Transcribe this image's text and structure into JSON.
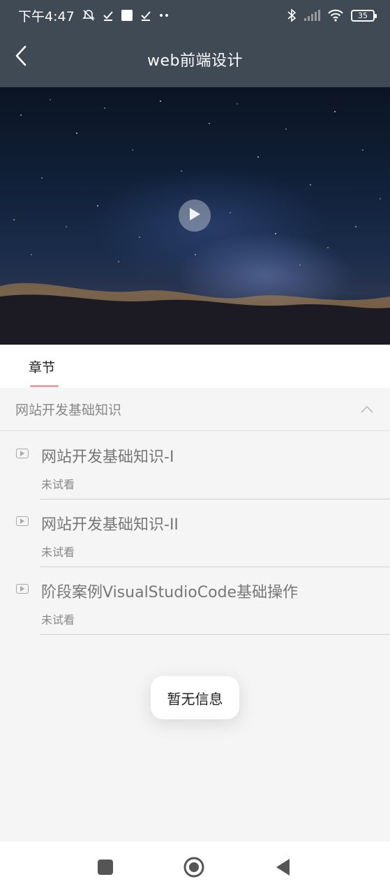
{
  "status_bar": {
    "time": "下午4:47",
    "battery": "35",
    "icons": [
      "alarm-off-icon",
      "check-icon",
      "square-icon",
      "check-icon",
      "more-dots-icon",
      "bluetooth-icon",
      "signal-icon",
      "wifi-icon",
      "battery-icon"
    ]
  },
  "header": {
    "title": "web前端设计",
    "back_icon": "chevron-left-icon"
  },
  "video": {
    "play_icon": "play-icon"
  },
  "tabs": [
    {
      "label": "章节",
      "active": true
    }
  ],
  "chapter": {
    "title": "网站开发基础知识",
    "expanded": true,
    "lessons": [
      {
        "title": "网站开发基础知识-I",
        "status": "未试看"
      },
      {
        "title": "网站开发基础知识-II",
        "status": "未试看"
      },
      {
        "title": "阶段案例VisualStudioCode基础操作",
        "status": "未试看"
      }
    ]
  },
  "toast": {
    "message": "暂无信息"
  },
  "nav": {
    "recent_icon": "square-icon",
    "home_icon": "circle-icon",
    "back_icon": "triangle-back-icon"
  },
  "colors": {
    "header_bg": "#3f4a55",
    "tab_indicator": "#f0a0a0",
    "page_bg": "#f5f5f5"
  }
}
